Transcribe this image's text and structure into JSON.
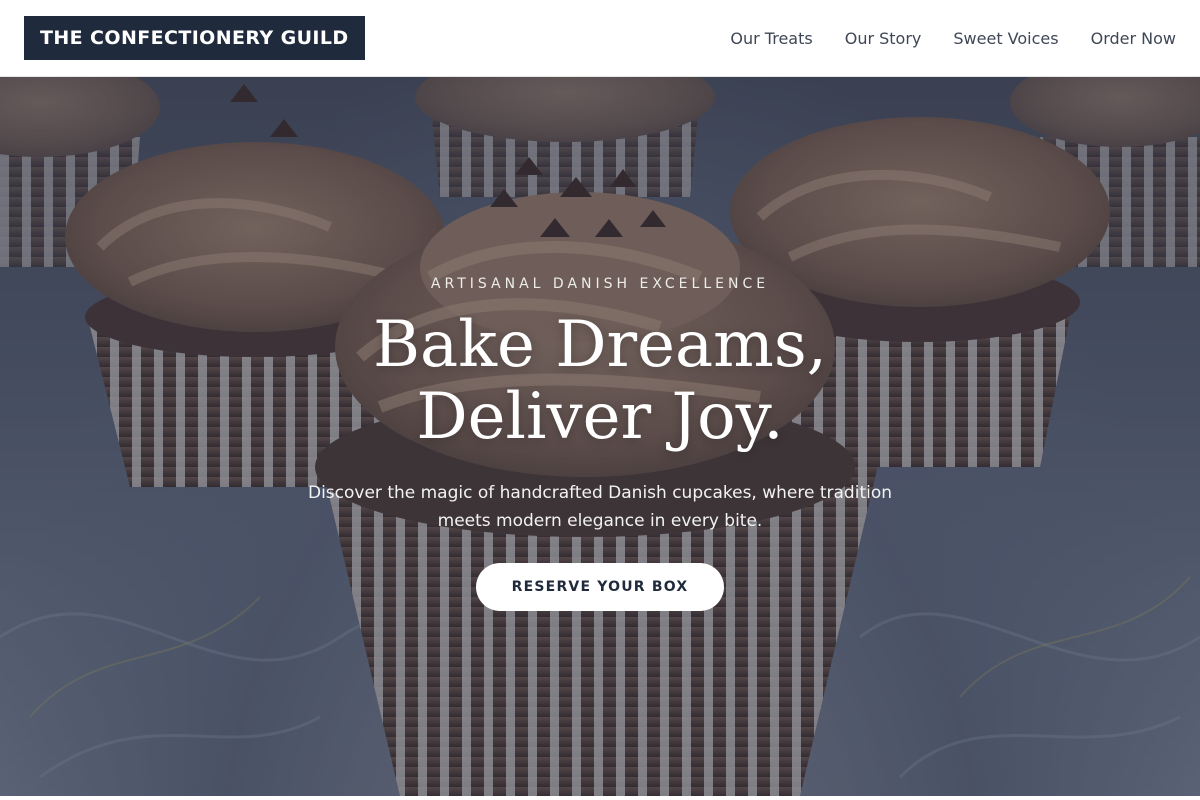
{
  "header": {
    "logo_text": "THE CONFECTIONERY GUILD",
    "nav": [
      {
        "label": "Our Treats"
      },
      {
        "label": "Our Story"
      },
      {
        "label": "Sweet Voices"
      },
      {
        "label": "Order Now"
      }
    ]
  },
  "hero": {
    "eyebrow": "ARTISANAL DANISH EXCELLENCE",
    "headline_line1": "Bake Dreams,",
    "headline_line2": "Deliver Joy.",
    "subtext": "Discover the magic of handcrafted Danish cupcakes, where tradition meets modern elegance in every bite.",
    "cta_label": "RESERVE YOUR BOX",
    "image": "chocolate-cupcakes-photo"
  },
  "colors": {
    "brand_dark": "#1f2a3d",
    "nav_text": "#3f4756",
    "overlay": "#283048",
    "cta_bg": "#ffffff"
  }
}
